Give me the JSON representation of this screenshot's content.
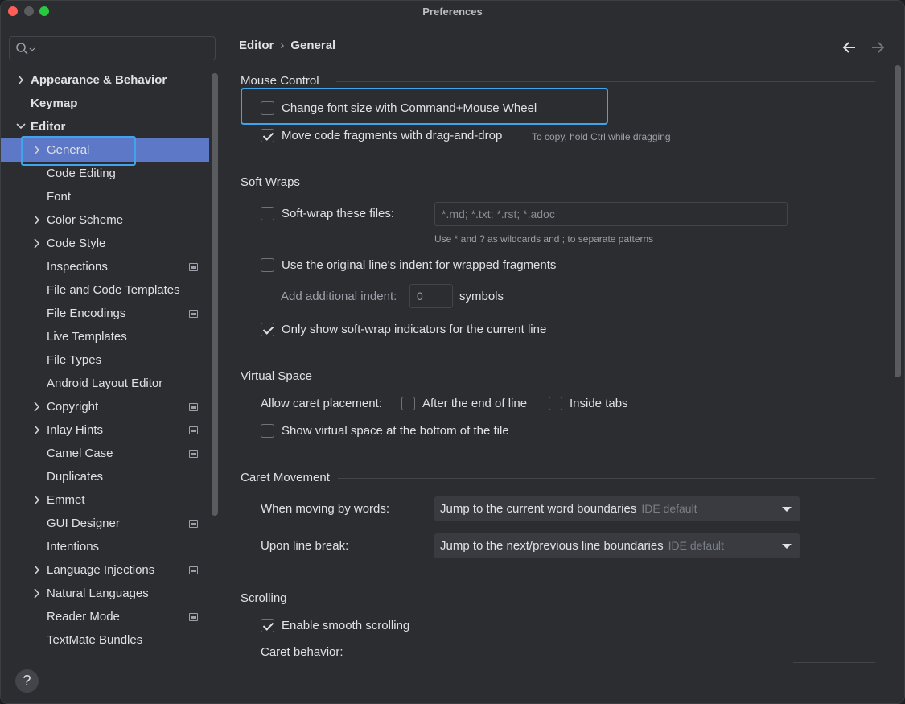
{
  "window": {
    "title": "Preferences"
  },
  "sidebar": {
    "search": {
      "placeholder": ""
    },
    "items": [
      {
        "label": "Appearance & Behavior",
        "bold": true,
        "chevron": "right",
        "indent": 0,
        "project": false
      },
      {
        "label": "Keymap",
        "bold": true,
        "chevron": "none",
        "indent": 0,
        "project": false
      },
      {
        "label": "Editor",
        "bold": true,
        "chevron": "down",
        "indent": 0,
        "project": false
      },
      {
        "label": "General",
        "bold": false,
        "chevron": "right",
        "indent": 1,
        "project": false,
        "selected": true
      },
      {
        "label": "Code Editing",
        "bold": false,
        "chevron": "none",
        "indent": 1,
        "project": false
      },
      {
        "label": "Font",
        "bold": false,
        "chevron": "none",
        "indent": 1,
        "project": false
      },
      {
        "label": "Color Scheme",
        "bold": false,
        "chevron": "right",
        "indent": 1,
        "project": false
      },
      {
        "label": "Code Style",
        "bold": false,
        "chevron": "right",
        "indent": 1,
        "project": false
      },
      {
        "label": "Inspections",
        "bold": false,
        "chevron": "none",
        "indent": 1,
        "project": true
      },
      {
        "label": "File and Code Templates",
        "bold": false,
        "chevron": "none",
        "indent": 1,
        "project": false
      },
      {
        "label": "File Encodings",
        "bold": false,
        "chevron": "none",
        "indent": 1,
        "project": true
      },
      {
        "label": "Live Templates",
        "bold": false,
        "chevron": "none",
        "indent": 1,
        "project": false
      },
      {
        "label": "File Types",
        "bold": false,
        "chevron": "none",
        "indent": 1,
        "project": false
      },
      {
        "label": "Android Layout Editor",
        "bold": false,
        "chevron": "none",
        "indent": 1,
        "project": false
      },
      {
        "label": "Copyright",
        "bold": false,
        "chevron": "right",
        "indent": 1,
        "project": true
      },
      {
        "label": "Inlay Hints",
        "bold": false,
        "chevron": "right",
        "indent": 1,
        "project": true
      },
      {
        "label": "Camel Case",
        "bold": false,
        "chevron": "none",
        "indent": 1,
        "project": true
      },
      {
        "label": "Duplicates",
        "bold": false,
        "chevron": "none",
        "indent": 1,
        "project": false
      },
      {
        "label": "Emmet",
        "bold": false,
        "chevron": "right",
        "indent": 1,
        "project": false
      },
      {
        "label": "GUI Designer",
        "bold": false,
        "chevron": "none",
        "indent": 1,
        "project": true
      },
      {
        "label": "Intentions",
        "bold": false,
        "chevron": "none",
        "indent": 1,
        "project": false
      },
      {
        "label": "Language Injections",
        "bold": false,
        "chevron": "right",
        "indent": 1,
        "project": true
      },
      {
        "label": "Natural Languages",
        "bold": false,
        "chevron": "right",
        "indent": 1,
        "project": false
      },
      {
        "label": "Reader Mode",
        "bold": false,
        "chevron": "none",
        "indent": 1,
        "project": true
      },
      {
        "label": "TextMate Bundles",
        "bold": false,
        "chevron": "none",
        "indent": 1,
        "project": false
      }
    ],
    "help_label": "?"
  },
  "header": {
    "breadcrumb_parent": "Editor",
    "breadcrumb_sep": "›",
    "breadcrumb_current": "General"
  },
  "mouse_control": {
    "title": "Mouse Control",
    "change_font_size": {
      "label": "Change font size with Command+Mouse Wheel",
      "checked": false
    },
    "move_code": {
      "label": "Move code fragments with drag-and-drop",
      "checked": true,
      "hint": "To copy, hold Ctrl while dragging"
    }
  },
  "soft_wraps": {
    "title": "Soft Wraps",
    "soft_wrap_files": {
      "label": "Soft-wrap these files:",
      "checked": false,
      "value": "*.md; *.txt; *.rst; *.adoc",
      "hint": "Use * and ? as wildcards and ; to separate patterns"
    },
    "original_indent": {
      "label": "Use the original line's indent for wrapped fragments",
      "checked": false
    },
    "additional_indent": {
      "label": "Add additional indent:",
      "value": "0",
      "unit": "symbols"
    },
    "only_show_indicators": {
      "label": "Only show soft-wrap indicators for the current line",
      "checked": true
    }
  },
  "virtual_space": {
    "title": "Virtual Space",
    "allow_caret_label": "Allow caret placement:",
    "after_end_of_line": {
      "label": "After the end of line",
      "checked": false
    },
    "inside_tabs": {
      "label": "Inside tabs",
      "checked": false
    },
    "show_virtual_space": {
      "label": "Show virtual space at the bottom of the file",
      "checked": false
    }
  },
  "caret_movement": {
    "title": "Caret Movement",
    "moving_by_words": {
      "label": "When moving by words:",
      "value": "Jump to the current word boundaries",
      "suffix": "IDE default"
    },
    "upon_line_break": {
      "label": "Upon line break:",
      "value": "Jump to the next/previous line boundaries",
      "suffix": "IDE default"
    }
  },
  "scrolling": {
    "title": "Scrolling",
    "smooth_scrolling": {
      "label": "Enable smooth scrolling",
      "checked": true
    },
    "caret_behavior_label": "Caret behavior:"
  },
  "colors": {
    "accent": "#3fa4ec",
    "selection": "#5d78c7",
    "background": "#2b2d30"
  },
  "icons": [
    "search-icon",
    "chevron-right-icon",
    "chevron-down-icon",
    "project-scope-icon",
    "back-arrow-icon",
    "forward-arrow-icon",
    "help-icon",
    "dropdown-caret-icon",
    "checkmark-icon"
  ]
}
